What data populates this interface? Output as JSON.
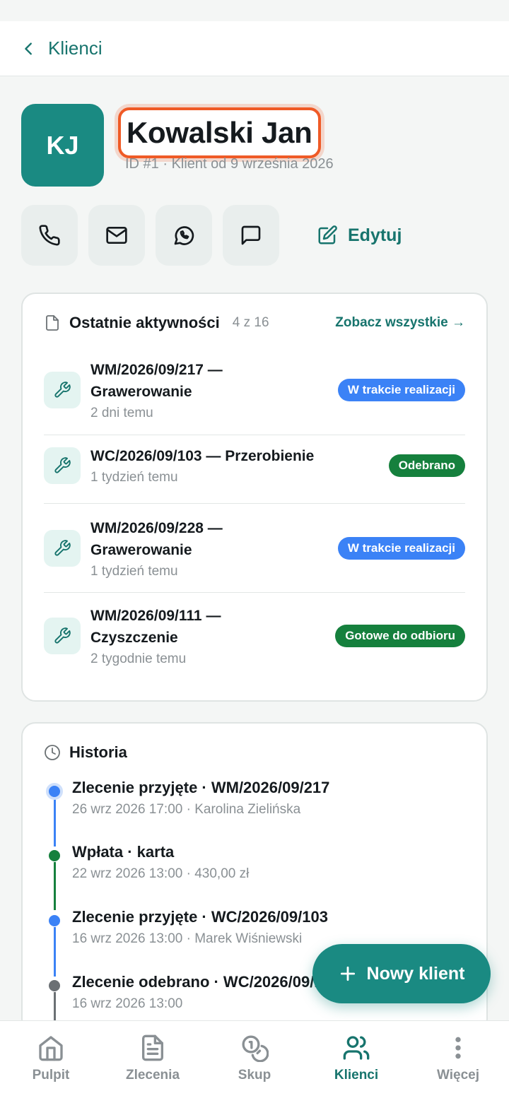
{
  "header": {
    "back_label": "Klienci"
  },
  "client": {
    "initials": "KJ",
    "name": "Kowalski Jan",
    "meta": "ID #1 · Klient od 9 września 2026"
  },
  "actions": {
    "edit_label": "Edytuj"
  },
  "activity": {
    "title": "Ostatnie aktywności",
    "count": "4 z 16",
    "see_all": "Zobacz wszystkie →",
    "items": [
      {
        "title_line1": "WM/2026/09/217 —",
        "title_line2": "Grawerowanie",
        "time": "2 dni temu",
        "status": "W trakcie realizacji",
        "status_color": "#3b82f6"
      },
      {
        "title_line1": "WC/2026/09/103 — Przerobienie",
        "title_line2": "",
        "time": "1 tydzień temu",
        "status": "Odebrano",
        "status_color": "#15803d"
      },
      {
        "title_line1": "WM/2026/09/228 —",
        "title_line2": "Grawerowanie",
        "time": "1 tydzień temu",
        "status": "W trakcie realizacji",
        "status_color": "#3b82f6"
      },
      {
        "title_line1": "WM/2026/09/111 —",
        "title_line2": "Czyszczenie",
        "time": "2 tygodnie temu",
        "status": "Gotowe do odbioru",
        "status_color": "#15803d"
      }
    ]
  },
  "history": {
    "title": "Historia",
    "items": [
      {
        "title": "Zlecenie przyjęte · WM/2026/09/217",
        "sub": "26 wrz 2026 17:00 · Karolina Zielińska",
        "color": "#3b82f6"
      },
      {
        "title": "Wpłata · karta",
        "sub": "22 wrz 2026 13:00 · 430,00 zł",
        "color": "#15803d"
      },
      {
        "title": "Zlecenie przyjęte · WC/2026/09/103",
        "sub": "16 wrz 2026 13:00 · Marek Wiśniewski",
        "color": "#3b82f6"
      },
      {
        "title": "Zlecenie odebrano · WC/2026/09/103",
        "sub": "16 wrz 2026 13:00",
        "color": "#6b7074"
      }
    ]
  },
  "fab": {
    "label": "Nowy klient"
  },
  "nav": {
    "items": [
      {
        "label": "Pulpit",
        "icon": "home-icon"
      },
      {
        "label": "Zlecenia",
        "icon": "document-icon"
      },
      {
        "label": "Skup",
        "icon": "coins-icon"
      },
      {
        "label": "Klienci",
        "icon": "users-icon"
      },
      {
        "label": "Więcej",
        "icon": "more-vertical-icon"
      }
    ],
    "active": "Klienci"
  }
}
